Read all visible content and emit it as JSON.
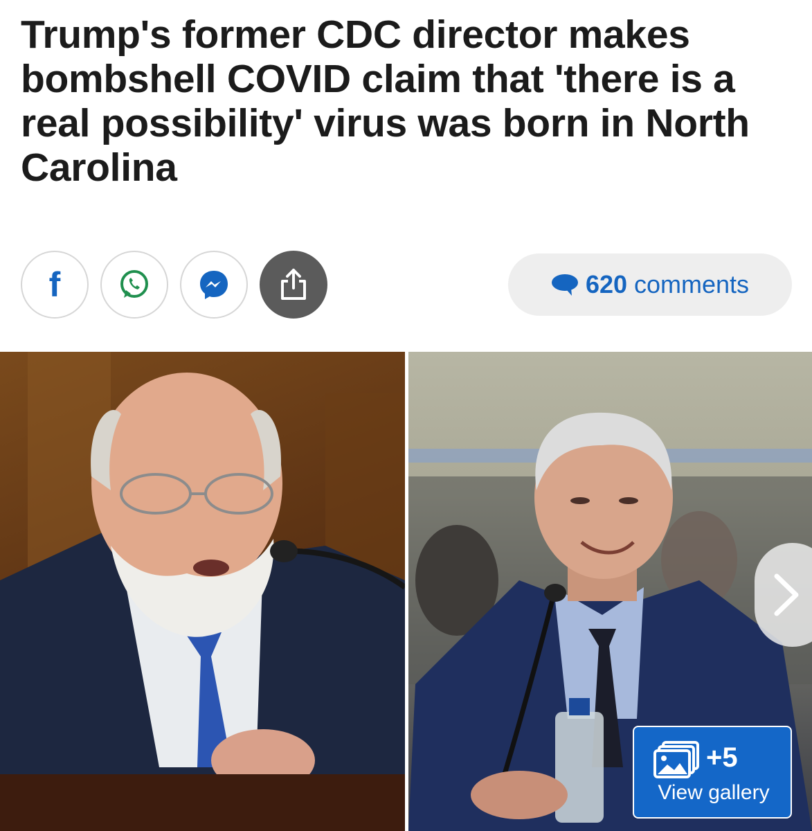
{
  "article": {
    "headline": "Trump's former CDC director makes bombshell COVID claim that 'there is a real possibility' virus was born in North Carolina"
  },
  "share": {
    "facebook_glyph": "f",
    "icons": [
      "facebook-icon",
      "whatsapp-icon",
      "messenger-icon",
      "share-icon"
    ]
  },
  "comments": {
    "count": "620",
    "label": "comments",
    "icon": "speech-bubble-icon",
    "color": "#1565c0"
  },
  "gallery": {
    "extra_count": "+5",
    "label": "View gallery",
    "badge_color": "#1467c8",
    "images": [
      "photo-robert-redfield",
      "photo-anthony-fauci"
    ]
  }
}
